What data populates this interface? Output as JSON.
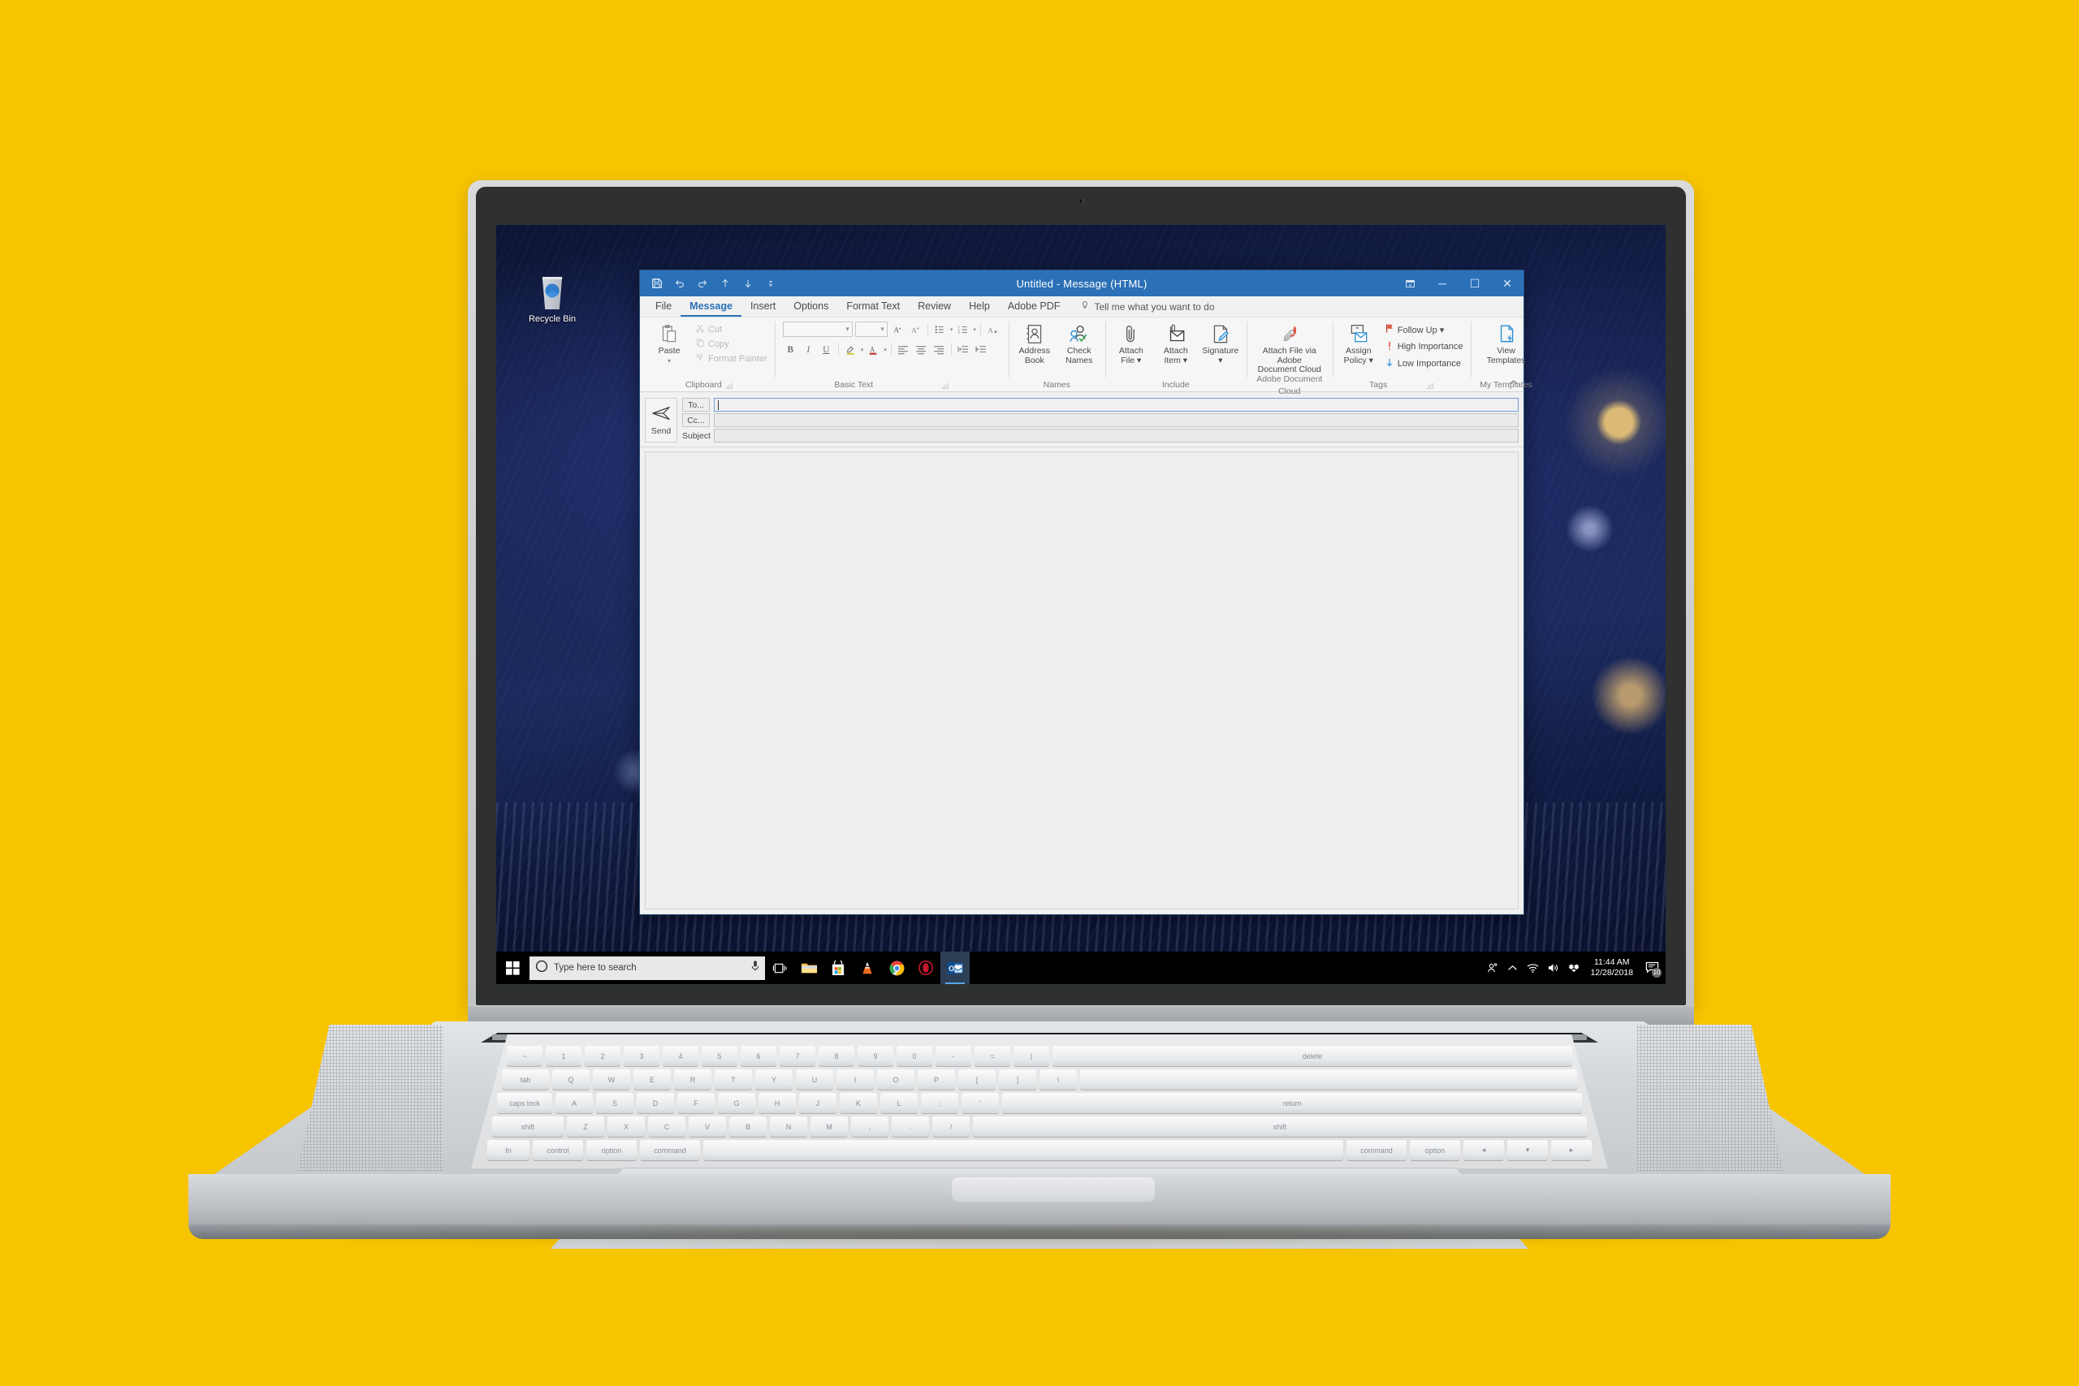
{
  "desktop": {
    "icons": [
      {
        "label": "Recycle Bin",
        "icon": "recycle-bin-icon"
      }
    ]
  },
  "outlook": {
    "title": "Untitled  -  Message (HTML)",
    "quick_access": [
      {
        "name": "save-icon",
        "label": "Save"
      },
      {
        "name": "undo-icon",
        "label": "Undo"
      },
      {
        "name": "redo-icon",
        "label": "Redo"
      },
      {
        "name": "previous-item-icon",
        "label": "Previous Item"
      },
      {
        "name": "next-item-icon",
        "label": "Next Item"
      },
      {
        "name": "customize-quick-access-icon",
        "label": "Customize Quick Access Toolbar"
      }
    ],
    "window_controls": {
      "ribbon_display": "Ribbon Display Options",
      "minimize": "─",
      "maximize": "☐",
      "close": "✕"
    },
    "tabs": [
      {
        "label": "File",
        "active": false
      },
      {
        "label": "Message",
        "active": true
      },
      {
        "label": "Insert",
        "active": false
      },
      {
        "label": "Options",
        "active": false
      },
      {
        "label": "Format Text",
        "active": false
      },
      {
        "label": "Review",
        "active": false
      },
      {
        "label": "Help",
        "active": false
      },
      {
        "label": "Adobe PDF",
        "active": false
      }
    ],
    "tell_me": "Tell me what you want to do",
    "ribbon": {
      "clipboard": {
        "label": "Clipboard",
        "paste": "Paste",
        "cut": "Cut",
        "copy": "Copy",
        "format_painter": "Format Painter"
      },
      "basic_text": {
        "label": "Basic Text",
        "font_name": "",
        "font_size": "",
        "grow_font": "A",
        "shrink_font": "A",
        "bullets": "Bullets",
        "numbering": "Numbering",
        "clear_formatting": "Clear All Formatting",
        "bold": "B",
        "italic": "I",
        "underline": "U",
        "text_highlight": "Text Highlight Color",
        "font_color": "A",
        "align_left": "Align Left",
        "center": "Center",
        "align_right": "Align Right",
        "decrease_indent": "Decrease Indent",
        "increase_indent": "Increase Indent"
      },
      "names": {
        "label": "Names",
        "address_book": "Address\nBook",
        "address_book_l1": "Address",
        "address_book_l2": "Book",
        "check_names_l1": "Check",
        "check_names_l2": "Names"
      },
      "include": {
        "label": "Include",
        "attach_file_l1": "Attach",
        "attach_file_l2": "File ▾",
        "attach_item_l1": "Attach",
        "attach_item_l2": "Item ▾",
        "signature_l1": "Signature",
        "signature_l2": "▾"
      },
      "adobe": {
        "label": "Adobe Document Cloud",
        "attach_l1": "Attach File via Adobe",
        "attach_l2": "Document Cloud"
      },
      "tags": {
        "label": "Tags",
        "assign_policy_l1": "Assign",
        "assign_policy_l2": "Policy ▾",
        "follow_up": "Follow Up ▾",
        "high_importance": "High Importance",
        "low_importance": "Low Importance"
      },
      "my_templates": {
        "label": "My Templates",
        "view_templates_l1": "View",
        "view_templates_l2": "Templates"
      },
      "collapse": "Collapse the Ribbon"
    },
    "compose": {
      "send": "Send",
      "to_label": "To...",
      "to_value": "",
      "cc_label": "Cc...",
      "cc_value": "",
      "subject_label": "Subject",
      "subject_value": "",
      "body_value": ""
    }
  },
  "taskbar": {
    "start": "Start",
    "search_placeholder": "Type here to search",
    "microphone": "cortana-microphone-icon",
    "task_view": "Task View",
    "pinned": [
      {
        "name": "file-explorer-icon",
        "label": "File Explorer"
      },
      {
        "name": "microsoft-store-icon",
        "label": "Microsoft Store"
      },
      {
        "name": "vlc-icon",
        "label": "VLC media player"
      },
      {
        "name": "chrome-icon",
        "label": "Google Chrome"
      },
      {
        "name": "opera-gx-icon",
        "label": "Opera"
      },
      {
        "name": "outlook-icon",
        "label": "Outlook",
        "active": true
      }
    ],
    "tray": [
      {
        "name": "people-icon",
        "label": "People"
      },
      {
        "name": "show-hidden-icons-icon",
        "label": "Show hidden icons"
      },
      {
        "name": "wifi-icon",
        "label": "Network"
      },
      {
        "name": "volume-icon",
        "label": "Volume"
      },
      {
        "name": "dropbox-icon",
        "label": "Dropbox"
      }
    ],
    "clock": {
      "time": "11:44 AM",
      "date": "12/28/2018"
    },
    "notifications": {
      "name": "action-center-icon",
      "count": "10"
    }
  },
  "colors": {
    "background": "#f7c400",
    "titlebar": "#2b71b8",
    "accent": "#2b71b8",
    "taskbar": "#000000",
    "ribbon": "#f6f6f6"
  }
}
